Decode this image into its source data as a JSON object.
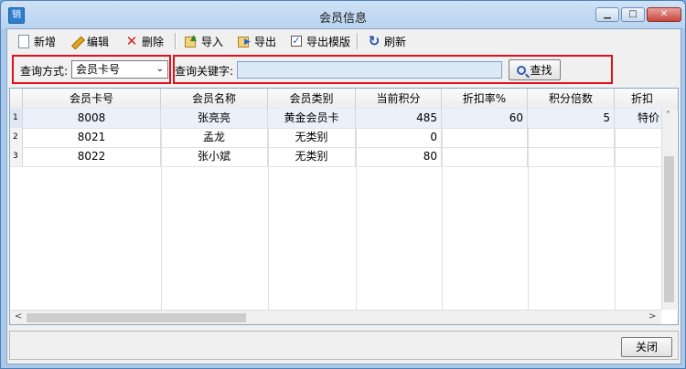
{
  "app_icon_text": "销",
  "window_title": "会员信息",
  "window_controls": {
    "minimize": "▁",
    "maximize": "□",
    "close": "✕"
  },
  "toolbar": {
    "new_label": "新增",
    "edit_label": "编辑",
    "delete_label": "删除",
    "import_label": "导入",
    "export_label": "导出",
    "export_template_label": "导出模版",
    "refresh_label": "刷新"
  },
  "query": {
    "mode_label": "查询方式:",
    "mode_value": "会员卡号",
    "keyword_label": "查询关键字:",
    "keyword_value": "",
    "search_label": "查找"
  },
  "table": {
    "columns": [
      "会员卡号",
      "会员名称",
      "会员类别",
      "当前积分",
      "折扣率%",
      "积分倍数",
      "折扣"
    ],
    "rows": [
      {
        "num": "1",
        "card": "8008",
        "name": "张亮亮",
        "type": "黄金会员卡",
        "points": "485",
        "discount": "60",
        "multiple": "5",
        "extra": "特价"
      },
      {
        "num": "2",
        "card": "8021",
        "name": "孟龙",
        "type": "无类别",
        "points": "0",
        "discount": "",
        "multiple": "",
        "extra": ""
      },
      {
        "num": "3",
        "card": "8022",
        "name": "张小斌",
        "type": "无类别",
        "points": "80",
        "discount": "",
        "multiple": "",
        "extra": ""
      }
    ]
  },
  "scroll_arrows": {
    "left": "<",
    "right": ">"
  },
  "footer": {
    "close_label": "关闭"
  },
  "colors": {
    "highlight_box": "#e0101a",
    "title_bar": "#b9d3ef"
  }
}
